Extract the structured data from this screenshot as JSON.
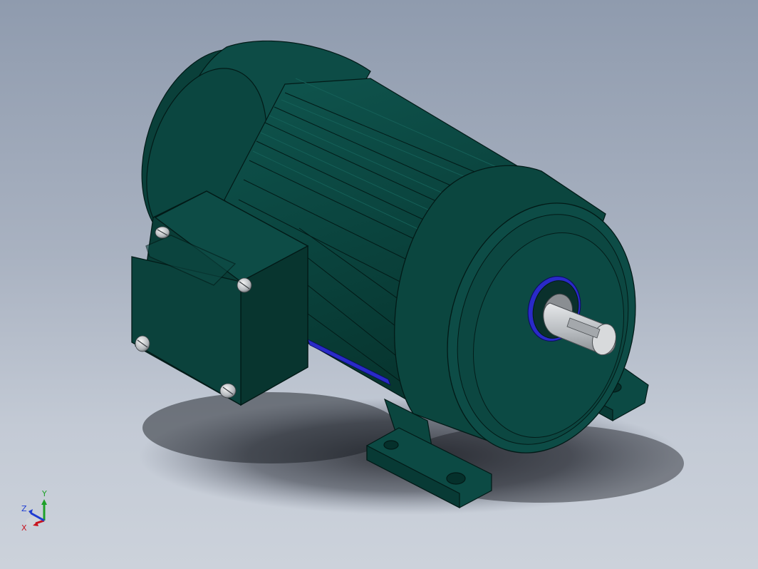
{
  "triad": {
    "x_label": "X",
    "y_label": "Y",
    "z_label": "Z"
  },
  "colors": {
    "housing": "#0c4a44",
    "housing_dark": "#05302b",
    "housing_light": "#176058",
    "shaft": "#c4c8cc",
    "seal_ring": "#2a2ac8",
    "background_top": "#8f9bae",
    "background_bottom": "#ccd2db",
    "axis_x": "#c8141e",
    "axis_y": "#1ea028",
    "axis_z": "#1e3cd2"
  }
}
